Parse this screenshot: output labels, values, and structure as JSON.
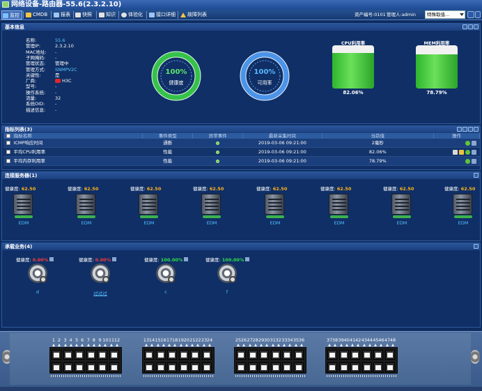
{
  "window": {
    "title": "网络设备-路由器-55.6(2.3.2.10)"
  },
  "toolbar": {
    "items": [
      {
        "label": "监控",
        "active": true,
        "icon": "monitor-icon",
        "color": "#7fc1ff"
      },
      {
        "label": "CMDB",
        "active": false,
        "icon": "database-icon",
        "color": "#f5c542"
      },
      {
        "label": "报表",
        "active": false,
        "icon": "report-icon",
        "color": "#9cc7f5"
      },
      {
        "label": "快照",
        "active": false,
        "icon": "snapshot-icon",
        "color": "#e2e2e2"
      },
      {
        "label": "知识",
        "active": false,
        "icon": "knowledge-icon",
        "color": "#e2e2e2"
      },
      {
        "label": "体验化",
        "active": false,
        "icon": "experience-icon",
        "color": "#e2e2e2"
      },
      {
        "label": "接口详细",
        "active": false,
        "icon": "interface-icon",
        "color": "#9cc7f5"
      },
      {
        "label": "故障列表",
        "active": false,
        "icon": "warning-icon",
        "color": "#f5c542"
      }
    ],
    "asset_no": "资产编号:0101",
    "admin": "管理人:admin",
    "special_select": "特殊取值..."
  },
  "basic": {
    "title": "基本信息",
    "fields": [
      {
        "k": "名称:",
        "v": "55.6",
        "style": "blue"
      },
      {
        "k": "管理IP:",
        "v": "2.3.2.10"
      },
      {
        "k": "MAC地址:",
        "v": "-"
      },
      {
        "k": "子网掩码:",
        "v": "-"
      },
      {
        "k": "管理状态:",
        "v": "管理中"
      },
      {
        "k": "管理方式:",
        "v": "SNMPV2C",
        "style": "blue"
      },
      {
        "k": "关键性:",
        "v": "是"
      },
      {
        "k": "厂商:",
        "v": "H3C"
      },
      {
        "k": "型号:",
        "v": "-"
      },
      {
        "k": "操作系统:",
        "v": "-"
      },
      {
        "k": "流量:",
        "v": "32"
      },
      {
        "k": "系统OID:",
        "v": "-"
      },
      {
        "k": "描述信息:",
        "v": "-"
      }
    ],
    "health": {
      "pct": "100%",
      "label": "健康度",
      "value": 1.0
    },
    "availability": {
      "pct": "100%",
      "label": "可用率",
      "value": 1.0
    },
    "cpu": {
      "title": "CPU利用率",
      "value": "82.06%",
      "fraction": 0.8206
    },
    "mem": {
      "title": "MEM利用率",
      "value": "78.79%",
      "fraction": 0.7879
    }
  },
  "metrics": {
    "title": "指标列表(3)",
    "columns": [
      "指标名称",
      "事件类型",
      "异常事件",
      "最新采集时间",
      "当前值",
      "操作"
    ],
    "rows": [
      {
        "name": "ICMP响应时间",
        "type": "通断",
        "time": "2019-03-06 09:21:00",
        "value": "2毫秒"
      },
      {
        "name": "平均CPU利用率",
        "type": "性能",
        "time": "2019-03-06 09:21:00",
        "value": "82.06%"
      },
      {
        "name": "平均内存利用率",
        "type": "性能",
        "time": "2019-03-06 09:21:00",
        "value": "78.79%"
      }
    ]
  },
  "servers": {
    "title": "连接服务器(1)",
    "health_label": "健康度:",
    "items": [
      {
        "score": "62.50",
        "name": "EDM"
      },
      {
        "score": "62.50",
        "name": "EDM"
      },
      {
        "score": "62.50",
        "name": "EDM"
      },
      {
        "score": "62.50",
        "name": "EDM"
      },
      {
        "score": "62.50",
        "name": "EDM"
      },
      {
        "score": "62.50",
        "name": "EDM"
      },
      {
        "score": "62.50",
        "name": "EDM"
      },
      {
        "score": "62.50",
        "name": "EDM"
      }
    ]
  },
  "services": {
    "title": "承载业务(4)",
    "health_label": "健康度:",
    "items": [
      {
        "score": "0.00%",
        "status": "red",
        "name": "d"
      },
      {
        "score": "0.00%",
        "status": "red",
        "name": "过过过"
      },
      {
        "score": "100.00%",
        "status": "green",
        "name": "c"
      },
      {
        "score": "100.00%",
        "status": "green",
        "name": "f"
      }
    ]
  },
  "ports": {
    "labels": [
      "1",
      "2",
      "3",
      "4",
      "5",
      "6",
      "7",
      "8",
      "9",
      "10",
      "11",
      "12",
      "13",
      "14",
      "15",
      "16",
      "17",
      "18",
      "19",
      "20",
      "21",
      "22",
      "23",
      "24",
      "25",
      "26",
      "27",
      "28",
      "29",
      "30",
      "31",
      "32",
      "33",
      "34",
      "35",
      "36",
      "37",
      "38",
      "39",
      "40",
      "41",
      "42",
      "43",
      "44",
      "45",
      "46",
      "47",
      "48"
    ]
  }
}
